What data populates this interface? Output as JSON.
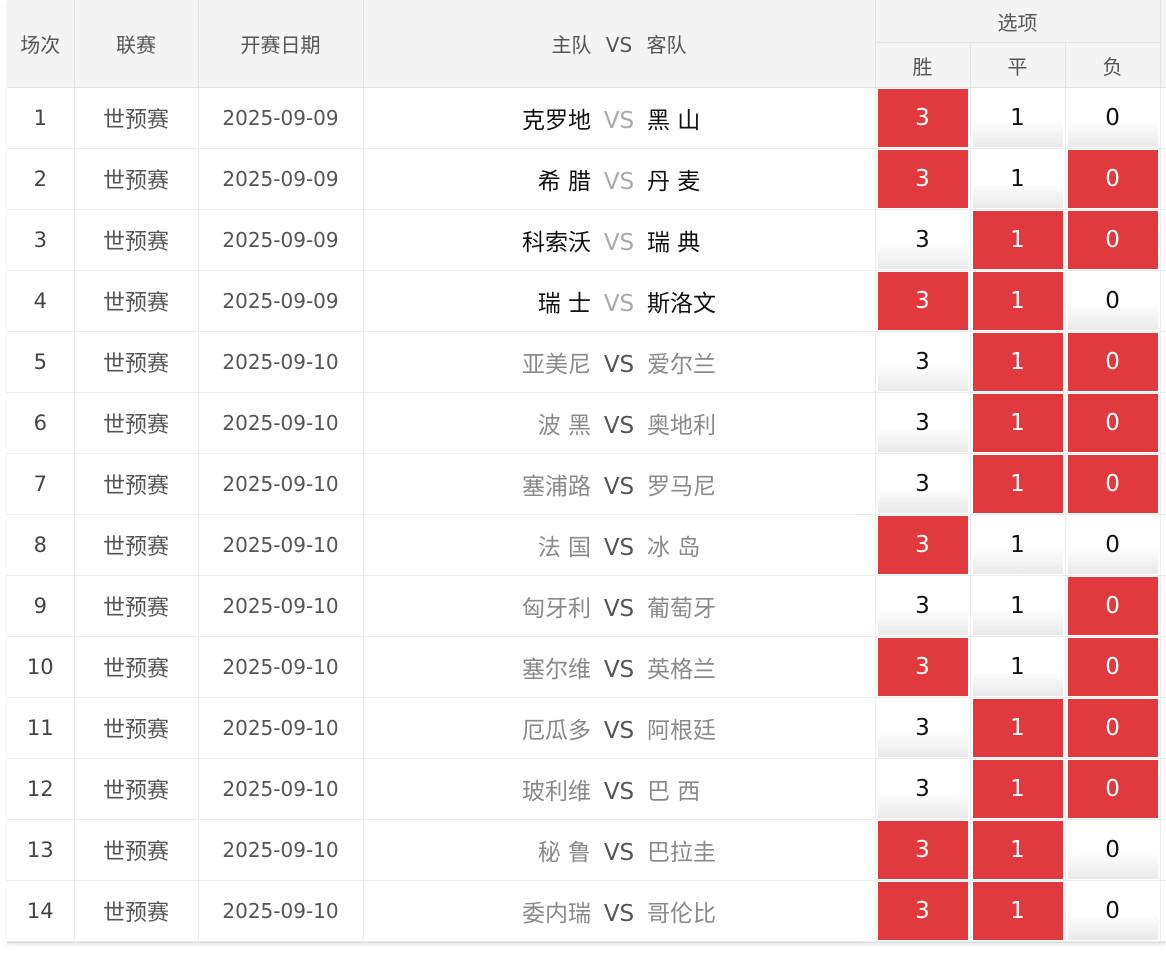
{
  "header": {
    "col_num": "场次",
    "col_league": "联赛",
    "col_date": "开赛日期",
    "col_home": "主队",
    "col_vs": "VS",
    "col_away": "客队",
    "col_options": "选项",
    "opt_win": "胜",
    "opt_draw": "平",
    "opt_loss": "负"
  },
  "colors": {
    "highlight": "#e0393e",
    "header_bg": "#f4f4f4"
  },
  "rows": [
    {
      "num": "1",
      "league": "世预赛",
      "date": "2025-09-09",
      "home": "克罗地",
      "vs": "VS",
      "away": "黑 山",
      "win": "3",
      "draw": "1",
      "loss": "0",
      "sel": [
        true,
        false,
        false
      ],
      "settled": true
    },
    {
      "num": "2",
      "league": "世预赛",
      "date": "2025-09-09",
      "home": "希 腊",
      "vs": "VS",
      "away": "丹 麦",
      "win": "3",
      "draw": "1",
      "loss": "0",
      "sel": [
        true,
        false,
        true
      ],
      "settled": true
    },
    {
      "num": "3",
      "league": "世预赛",
      "date": "2025-09-09",
      "home": "科索沃",
      "vs": "VS",
      "away": "瑞 典",
      "win": "3",
      "draw": "1",
      "loss": "0",
      "sel": [
        false,
        true,
        true
      ],
      "settled": true
    },
    {
      "num": "4",
      "league": "世预赛",
      "date": "2025-09-09",
      "home": "瑞 士",
      "vs": "VS",
      "away": "斯洛文",
      "win": "3",
      "draw": "1",
      "loss": "0",
      "sel": [
        true,
        true,
        false
      ],
      "settled": true
    },
    {
      "num": "5",
      "league": "世预赛",
      "date": "2025-09-10",
      "home": "亚美尼",
      "vs": "VS",
      "away": "爱尔兰",
      "win": "3",
      "draw": "1",
      "loss": "0",
      "sel": [
        false,
        true,
        true
      ],
      "settled": false
    },
    {
      "num": "6",
      "league": "世预赛",
      "date": "2025-09-10",
      "home": "波 黑",
      "vs": "VS",
      "away": "奥地利",
      "win": "3",
      "draw": "1",
      "loss": "0",
      "sel": [
        false,
        true,
        true
      ],
      "settled": false
    },
    {
      "num": "7",
      "league": "世预赛",
      "date": "2025-09-10",
      "home": "塞浦路",
      "vs": "VS",
      "away": "罗马尼",
      "win": "3",
      "draw": "1",
      "loss": "0",
      "sel": [
        false,
        true,
        true
      ],
      "settled": false
    },
    {
      "num": "8",
      "league": "世预赛",
      "date": "2025-09-10",
      "home": "法 国",
      "vs": "VS",
      "away": "冰 岛",
      "win": "3",
      "draw": "1",
      "loss": "0",
      "sel": [
        true,
        false,
        false
      ],
      "settled": false
    },
    {
      "num": "9",
      "league": "世预赛",
      "date": "2025-09-10",
      "home": "匈牙利",
      "vs": "VS",
      "away": "葡萄牙",
      "win": "3",
      "draw": "1",
      "loss": "0",
      "sel": [
        false,
        false,
        true
      ],
      "settled": false
    },
    {
      "num": "10",
      "league": "世预赛",
      "date": "2025-09-10",
      "home": "塞尔维",
      "vs": "VS",
      "away": "英格兰",
      "win": "3",
      "draw": "1",
      "loss": "0",
      "sel": [
        true,
        false,
        true
      ],
      "settled": false
    },
    {
      "num": "11",
      "league": "世预赛",
      "date": "2025-09-10",
      "home": "厄瓜多",
      "vs": "VS",
      "away": "阿根廷",
      "win": "3",
      "draw": "1",
      "loss": "0",
      "sel": [
        false,
        true,
        true
      ],
      "settled": false
    },
    {
      "num": "12",
      "league": "世预赛",
      "date": "2025-09-10",
      "home": "玻利维",
      "vs": "VS",
      "away": "巴 西",
      "win": "3",
      "draw": "1",
      "loss": "0",
      "sel": [
        false,
        true,
        true
      ],
      "settled": false
    },
    {
      "num": "13",
      "league": "世预赛",
      "date": "2025-09-10",
      "home": "秘 鲁",
      "vs": "VS",
      "away": "巴拉圭",
      "win": "3",
      "draw": "1",
      "loss": "0",
      "sel": [
        true,
        true,
        false
      ],
      "settled": false
    },
    {
      "num": "14",
      "league": "世预赛",
      "date": "2025-09-10",
      "home": "委内瑞",
      "vs": "VS",
      "away": "哥伦比",
      "win": "3",
      "draw": "1",
      "loss": "0",
      "sel": [
        true,
        true,
        false
      ],
      "settled": false
    }
  ]
}
